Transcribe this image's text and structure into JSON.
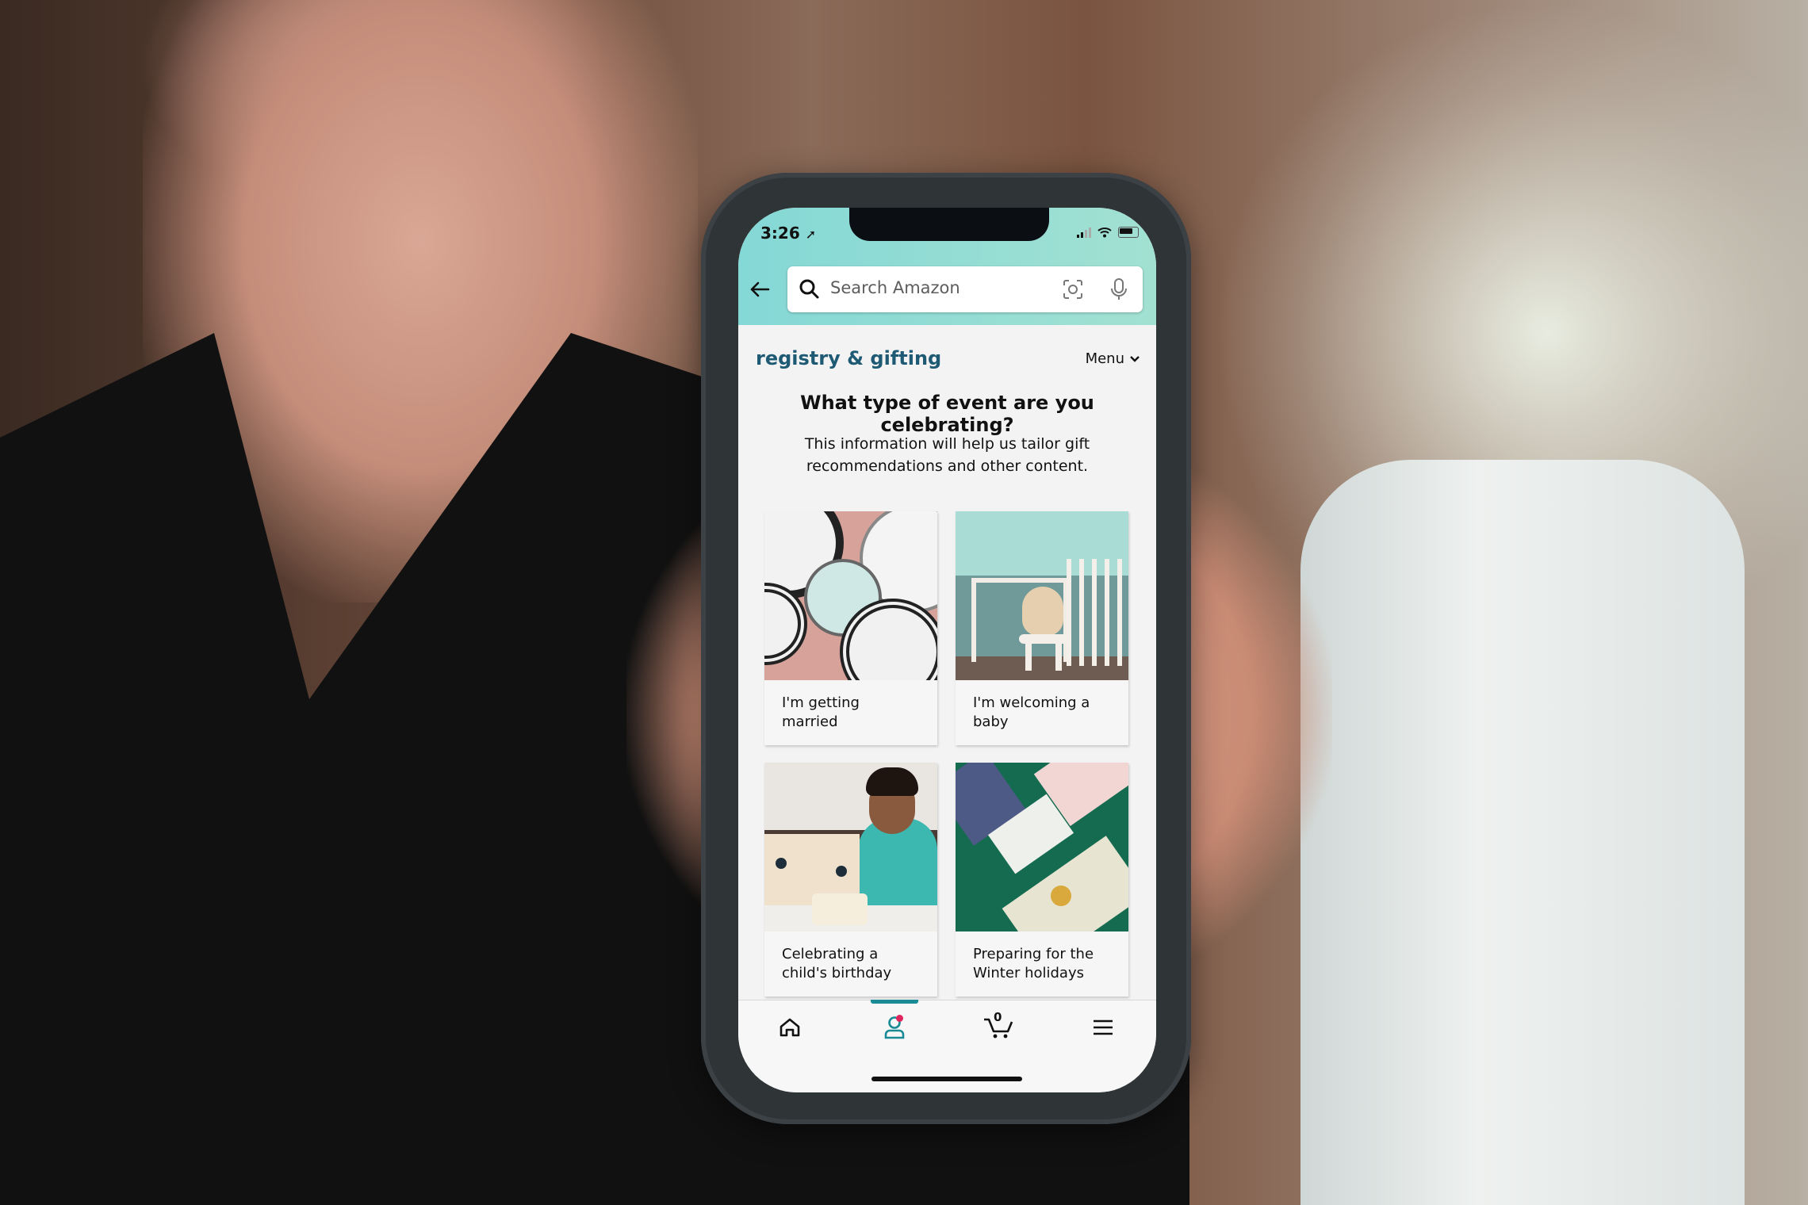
{
  "status_bar": {
    "time": "3:26"
  },
  "search": {
    "placeholder": "Search Amazon"
  },
  "page": {
    "brand": "registry & gifting",
    "menu_label": "Menu",
    "question": "What type of event are you celebrating?",
    "subtext": "This information will help us tailor gift recommendations and other content."
  },
  "events": [
    {
      "label": "I'm getting married",
      "image": "wedding table setting"
    },
    {
      "label": "I'm welcoming a baby",
      "image": "nursery with teddy bear"
    },
    {
      "label": "Celebrating a child's birthday",
      "image": "child opening present"
    },
    {
      "label": "Preparing for the Winter holidays",
      "image": "wrapped holiday gifts"
    }
  ],
  "tabbar": {
    "items": [
      {
        "icon": "home-icon",
        "label": "Home"
      },
      {
        "icon": "account-icon",
        "label": "Account",
        "active": true,
        "notification": true
      },
      {
        "icon": "cart-icon",
        "label": "Cart",
        "count": "0"
      },
      {
        "icon": "menu-icon",
        "label": "Menu"
      }
    ]
  },
  "colors": {
    "header_gradient_start": "#84d8d6",
    "brand": "#1f5a74",
    "active_tab": "#1a8a95",
    "notification": "#e0245e"
  }
}
